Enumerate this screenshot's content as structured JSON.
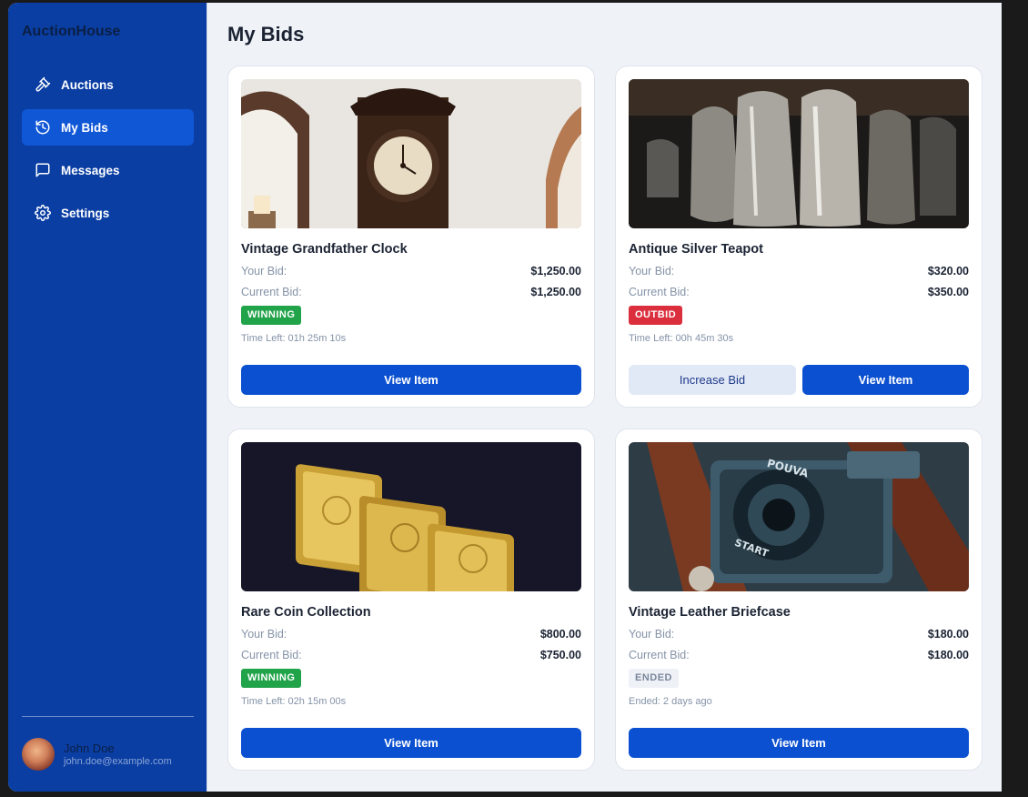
{
  "app": {
    "brand": "AuctionHouse"
  },
  "sidebar": {
    "items": [
      {
        "label": "Auctions",
        "icon": "gavel-icon"
      },
      {
        "label": "My Bids",
        "icon": "history-icon",
        "active": true
      },
      {
        "label": "Messages",
        "icon": "message-icon"
      },
      {
        "label": "Settings",
        "icon": "gear-icon"
      }
    ]
  },
  "user": {
    "name": "John Doe",
    "email": "john.doe@example.com"
  },
  "page": {
    "title": "My Bids"
  },
  "labels": {
    "your_bid": "Your Bid:",
    "current_bid": "Current Bid:"
  },
  "bids": [
    {
      "title": "Vintage Grandfather Clock",
      "your_bid": "$1,250.00",
      "current_bid": "$1,250.00",
      "status": "WINNING",
      "time": "Time Left: 01h 25m 10s",
      "primary_button": "View Item",
      "image": "grandfather-clock"
    },
    {
      "title": "Antique Silver Teapot",
      "your_bid": "$320.00",
      "current_bid": "$350.00",
      "status": "OUTBID",
      "time": "Time Left: 00h 45m 30s",
      "secondary_button": "Increase Bid",
      "primary_button": "View Item",
      "image": "silver-teapots"
    },
    {
      "title": "Rare Coin Collection",
      "your_bid": "$800.00",
      "current_bid": "$750.00",
      "status": "WINNING",
      "time": "Time Left: 02h 15m 00s",
      "primary_button": "View Item",
      "image": "gold-bars"
    },
    {
      "title": "Vintage Leather Briefcase",
      "your_bid": "$180.00",
      "current_bid": "$180.00",
      "status": "ENDED",
      "time": "Ended: 2 days ago",
      "primary_button": "View Item",
      "image": "vintage-camera"
    }
  ],
  "image_text": {
    "camera_brand": "POUVA",
    "camera_start": "START"
  },
  "colors": {
    "sidebar": "#0a3ea3",
    "active_nav": "#1057d6",
    "primary_button": "#0b50d0",
    "winning": "#21a34a",
    "outbid": "#db2f3d"
  }
}
